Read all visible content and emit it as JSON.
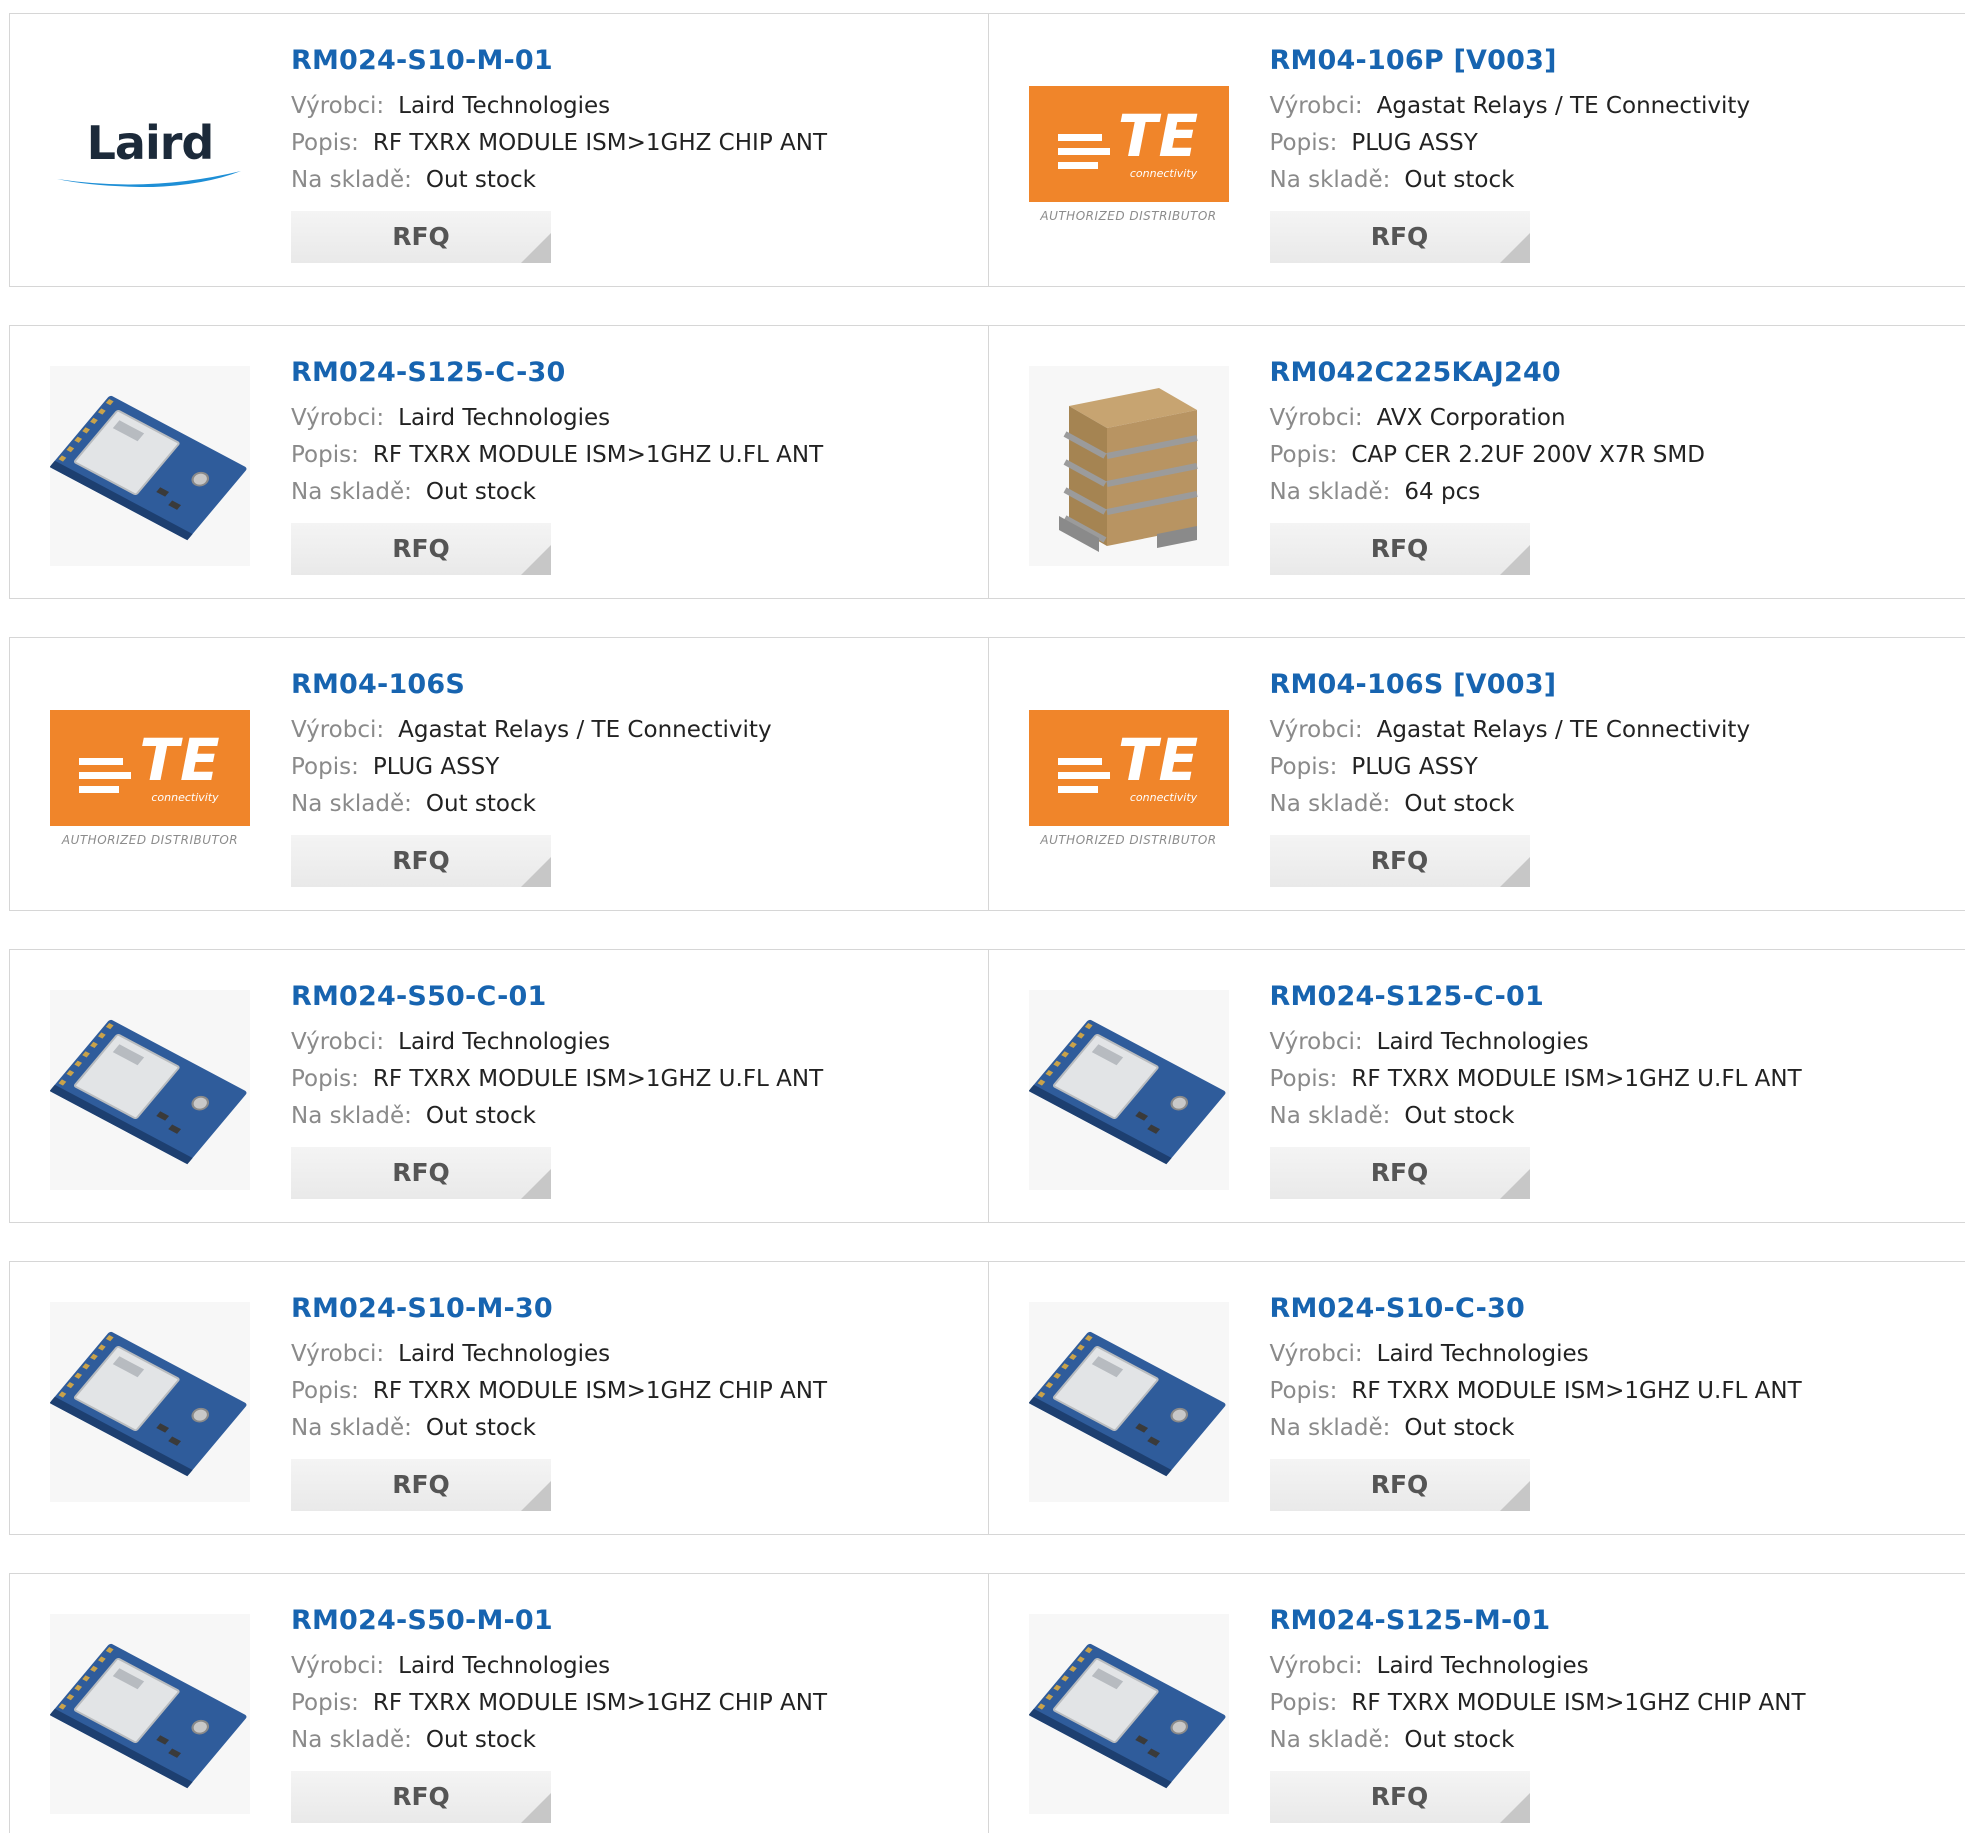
{
  "labels": {
    "manufacturer": "Výrobci:",
    "description": "Popis:",
    "stock": "Na skladě:",
    "rfq": "RFQ"
  },
  "logos": {
    "laird": "Laird",
    "te_mark": "TE",
    "te_sub": "connectivity",
    "te_authorized": "AUTHORIZED DISTRIBUTOR"
  },
  "colors": {
    "link": "#1764b0",
    "te_orange": "#f0852a",
    "laird_swoosh": "#1e8fd6"
  },
  "products": [
    {
      "part": "RM024-S10-M-01",
      "manufacturer": "Laird Technologies",
      "description": "RF TXRX MODULE ISM>1GHZ CHIP ANT",
      "stock": "Out stock",
      "image": "laird-logo"
    },
    {
      "part": "RM04-106P [V003]",
      "manufacturer": "Agastat Relays / TE Connectivity",
      "description": "PLUG ASSY",
      "stock": "Out stock",
      "image": "te-logo"
    },
    {
      "part": "RM024-S125-C-30",
      "manufacturer": "Laird Technologies",
      "description": "RF TXRX MODULE ISM>1GHZ U.FL ANT",
      "stock": "Out stock",
      "image": "rf-module-photo"
    },
    {
      "part": "RM042C225KAJ240",
      "manufacturer": "AVX Corporation",
      "description": "CAP CER 2.2UF 200V X7R SMD",
      "stock": "64 pcs",
      "image": "capacitor-stack-photo"
    },
    {
      "part": "RM04-106S",
      "manufacturer": "Agastat Relays / TE Connectivity",
      "description": "PLUG ASSY",
      "stock": "Out stock",
      "image": "te-logo"
    },
    {
      "part": "RM04-106S [V003]",
      "manufacturer": "Agastat Relays / TE Connectivity",
      "description": "PLUG ASSY",
      "stock": "Out stock",
      "image": "te-logo"
    },
    {
      "part": "RM024-S50-C-01",
      "manufacturer": "Laird Technologies",
      "description": "RF TXRX MODULE ISM>1GHZ U.FL ANT",
      "stock": "Out stock",
      "image": "rf-module-photo"
    },
    {
      "part": "RM024-S125-C-01",
      "manufacturer": "Laird Technologies",
      "description": "RF TXRX MODULE ISM>1GHZ U.FL ANT",
      "stock": "Out stock",
      "image": "rf-module-photo"
    },
    {
      "part": "RM024-S10-M-30",
      "manufacturer": "Laird Technologies",
      "description": "RF TXRX MODULE ISM>1GHZ CHIP ANT",
      "stock": "Out stock",
      "image": "rf-module-photo"
    },
    {
      "part": "RM024-S10-C-30",
      "manufacturer": "Laird Technologies",
      "description": "RF TXRX MODULE ISM>1GHZ U.FL ANT",
      "stock": "Out stock",
      "image": "rf-module-photo"
    },
    {
      "part": "RM024-S50-M-01",
      "manufacturer": "Laird Technologies",
      "description": "RF TXRX MODULE ISM>1GHZ CHIP ANT",
      "stock": "Out stock",
      "image": "rf-module-photo"
    },
    {
      "part": "RM024-S125-M-01",
      "manufacturer": "Laird Technologies",
      "description": "RF TXRX MODULE ISM>1GHZ CHIP ANT",
      "stock": "Out stock",
      "image": "rf-module-photo"
    }
  ]
}
